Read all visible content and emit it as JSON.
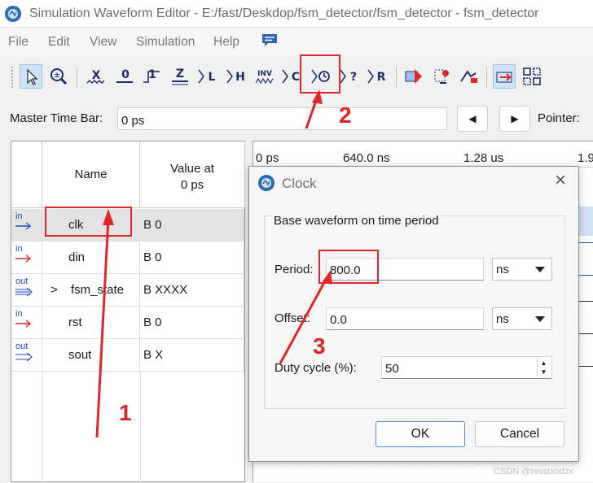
{
  "window": {
    "title": "Simulation Waveform Editor - E:/fast/Deskdop/fsm_detector/fsm_detector - fsm_detector"
  },
  "menu": [
    "File",
    "Edit",
    "View",
    "Simulation",
    "Help"
  ],
  "toolbar": {
    "buttons": [
      {
        "name": "select-pointer",
        "glyph": "arrow"
      },
      {
        "name": "zoom",
        "glyph": "zoom"
      },
      {
        "name": "forcing-unknown",
        "glyph": "X"
      },
      {
        "name": "forcing-low",
        "glyph": "0"
      },
      {
        "name": "forcing-high",
        "glyph": "1"
      },
      {
        "name": "high-impedance",
        "glyph": "Z"
      },
      {
        "name": "weak-low",
        "glyph": "L"
      },
      {
        "name": "weak-high",
        "glyph": "H"
      },
      {
        "name": "invert",
        "glyph": "INV"
      },
      {
        "name": "count-value",
        "glyph": "C"
      },
      {
        "name": "overwrite-clock",
        "glyph": "clock"
      },
      {
        "name": "arbitrary-value",
        "glyph": "?"
      },
      {
        "name": "random-value",
        "glyph": "R"
      }
    ]
  },
  "time_bar": {
    "label": "Master Time Bar:",
    "value": "0 ps",
    "pointer_label": "Pointer:"
  },
  "grid": {
    "headers": {
      "name": "Name",
      "value": "Value at",
      "value2": "0 ps"
    },
    "rows": [
      {
        "type": "in",
        "name": "clk",
        "value": "B 0",
        "selected": true
      },
      {
        "type": "in",
        "name": "din",
        "value": "B 0"
      },
      {
        "type": "out",
        "name": "fsm_state",
        "value": "B XXXX",
        "expand": ">"
      },
      {
        "type": "in",
        "name": "rst",
        "value": "B 0"
      },
      {
        "type": "out",
        "name": "sout",
        "value": "B X"
      }
    ]
  },
  "ruler": [
    "0 ps",
    "640.0 ns",
    "1.28 us",
    "1.9"
  ],
  "dialog": {
    "title": "Clock",
    "group": "Base waveform on time period",
    "period_label": "Period:",
    "period_value": "800.0",
    "period_unit": "ns",
    "offset_label": "Offset:",
    "offset_value": "0.0",
    "offset_unit": "ns",
    "duty_label": "Duty cycle (%):",
    "duty_value": "50",
    "ok": "OK",
    "cancel": "Cancel"
  },
  "annotations": [
    "1",
    "2",
    "3"
  ],
  "watermark": "CSDN @rexstxndzx",
  "colors": {
    "annotation": "#e0262b",
    "pin": "#1b4bbb",
    "selection": "#cde3f7"
  }
}
